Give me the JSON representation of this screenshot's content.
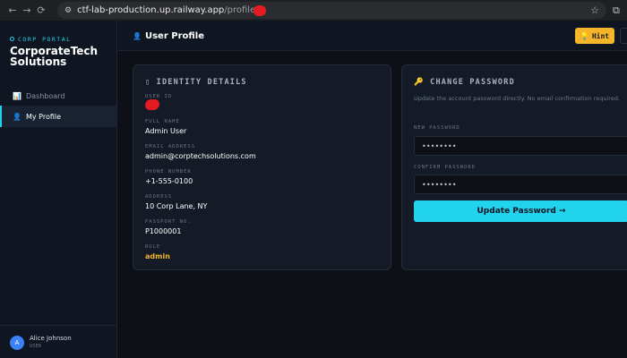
{
  "browser": {
    "url_host": "ctf-lab-production.up.railway.app",
    "url_path": "/profile"
  },
  "sidebar": {
    "brand_small": "CORP PORTAL",
    "brand_line1": "CorporateTech",
    "brand_line2": "Solutions",
    "items": [
      {
        "label": "Dashboard",
        "icon": "chart-icon"
      },
      {
        "label": "My Profile",
        "icon": "profile-icon"
      }
    ],
    "user": {
      "name": "Alice Johnson",
      "role": "USER",
      "initial": "A"
    }
  },
  "topbar": {
    "title": "User Profile",
    "hint_label": "Hint"
  },
  "identity": {
    "title": "IDENTITY DETAILS",
    "fields": [
      {
        "label": "USER ID",
        "value": ""
      },
      {
        "label": "FULL NAME",
        "value": "Admin User"
      },
      {
        "label": "EMAIL ADDRESS",
        "value": "admin@corptechsolutions.com"
      },
      {
        "label": "PHONE NUMBER",
        "value": "+1-555-0100"
      },
      {
        "label": "ADDRESS",
        "value": "10 Corp Lane, NY"
      },
      {
        "label": "PASSPORT NO.",
        "value": "P1000001"
      },
      {
        "label": "ROLE",
        "value": "admin"
      }
    ]
  },
  "password": {
    "title": "CHANGE PASSWORD",
    "description": "Update the account password directly. No email confirmation required.",
    "new_label": "NEW PASSWORD",
    "new_value": "••••••••",
    "confirm_label": "CONFIRM PASSWORD",
    "confirm_value": "••••••••",
    "button_label": "Update Password →"
  },
  "colors": {
    "accent": "#22d3ee",
    "hint": "#f5b52a",
    "background": "#0d1117"
  }
}
